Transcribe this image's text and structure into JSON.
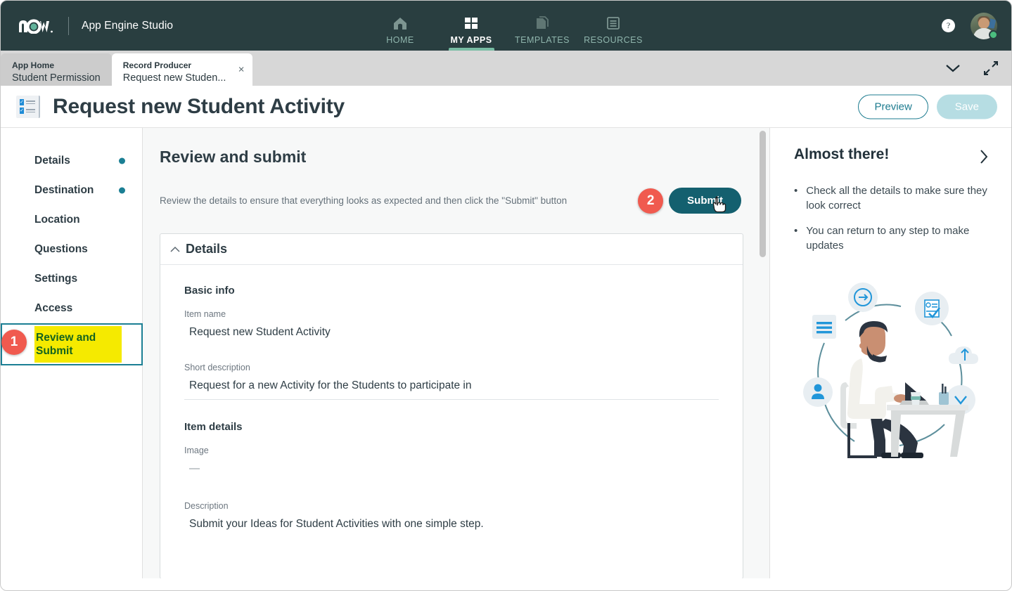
{
  "topbar": {
    "logo_name": "now-logo",
    "app_name": "App Engine Studio",
    "nav": [
      {
        "label": "HOME",
        "icon": "home-icon",
        "active": false
      },
      {
        "label": "MY APPS",
        "icon": "grid-icon",
        "active": true
      },
      {
        "label": "TEMPLATES",
        "icon": "templates-icon",
        "active": false
      },
      {
        "label": "RESOURCES",
        "icon": "resources-icon",
        "active": false
      }
    ],
    "help_glyph": "?",
    "avatar_status": "online"
  },
  "tabs": [
    {
      "sub": "App Home",
      "main": "Student Permission",
      "active": false
    },
    {
      "sub": "Record Producer",
      "main": "Request new Studen...",
      "active": true,
      "close": "×"
    }
  ],
  "page": {
    "title": "Request new Student Activity",
    "preview_label": "Preview",
    "save_label": "Save"
  },
  "sidebar": {
    "items": [
      {
        "label": "Details",
        "dot": true
      },
      {
        "label": "Destination",
        "dot": true
      },
      {
        "label": "Location",
        "dot": false
      },
      {
        "label": "Questions",
        "dot": false
      },
      {
        "label": "Settings",
        "dot": false
      },
      {
        "label": "Access",
        "dot": false
      },
      {
        "label": "Review and Submit",
        "dot": false,
        "highlighted": true
      }
    ]
  },
  "annotations": [
    {
      "number": "1",
      "target": "sidebar-item-review-and-submit"
    },
    {
      "number": "2",
      "target": "submit-button"
    }
  ],
  "main": {
    "heading": "Review and submit",
    "instruction": "Review the details to ensure that everything looks as expected and then click the \"Submit\" button",
    "submit_label": "Submit",
    "card": {
      "title": "Details",
      "collapse_icon": "chevron-up-icon",
      "sections": [
        {
          "title": "Basic info",
          "fields": [
            {
              "label": "Item name",
              "value": "Request new Student Activity",
              "underline": false
            },
            {
              "label": "Short description",
              "value": "Request for a new Activity for the Students to participate in",
              "underline": true
            }
          ]
        },
        {
          "title": "Item details",
          "fields": [
            {
              "label": "Image",
              "value": "—",
              "underline": false
            },
            {
              "label": "Description",
              "value": "Submit your Ideas for Student Activities with one simple step.",
              "underline": false
            }
          ]
        }
      ]
    }
  },
  "rightpanel": {
    "title": "Almost there!",
    "chevron": "chevron-right-icon",
    "bullets": [
      "Check all the details to make sure they look correct",
      "You can return to any step to make updates"
    ],
    "bullet_glyph": "•",
    "illustration": "person-at-desk-illustration"
  },
  "colors": {
    "nav_bg": "#293e40",
    "accent_teal": "#1b7f94",
    "submit_teal": "#14606f",
    "badge_red": "#f05a4f",
    "highlight_yellow": "#f5ea00",
    "highlight_text_green": "#14631f",
    "status_green": "#4bbd7f"
  }
}
